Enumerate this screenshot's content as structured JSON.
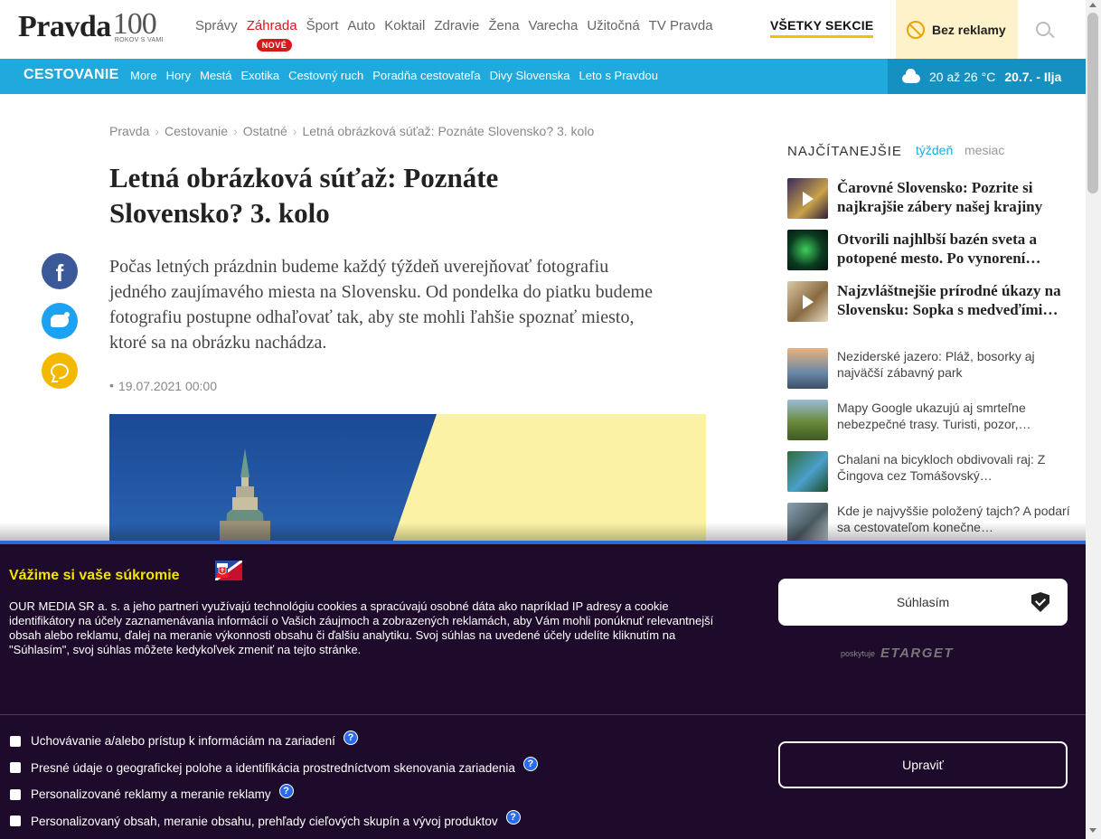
{
  "header": {
    "logo_word": "Pravda",
    "logo_number": "100",
    "logo_sub": "ROKOV S VAMI",
    "nav": [
      "Správy",
      "Záhrada",
      "Šport",
      "Auto",
      "Koktail",
      "Zdravie",
      "Žena",
      "Varecha",
      "Užitočná",
      "TV Pravda"
    ],
    "nav_active_index": 1,
    "new_badge": "NOVÉ",
    "all_sections": "VŠETKY SEKCIE",
    "no_ads": "Bez reklamy"
  },
  "section_bar": {
    "title": "CESTOVANIE",
    "links": [
      "More",
      "Hory",
      "Mestá",
      "Exotika",
      "Cestovný ruch",
      "Poradňa cestovateľa",
      "Divy Slovenska",
      "Leto s Pravdou"
    ],
    "weather_temp": "20 až 26 °C",
    "weather_date": "20.7. - Ilja"
  },
  "breadcrumb": [
    "Pravda",
    "Cestovanie",
    "Ostatné",
    "Letná obrázková súťaž: Poznáte Slovensko? 3. kolo"
  ],
  "article": {
    "title": "Letná obrázková súťaž: Poznáte Slovensko? 3. kolo",
    "perex": "Počas letných prázdnin budeme každý týždeň uverejňovať fotografiu jedného zaujímavého miesta na Slovensku. Od pondelka do piatku budeme fotografiu postupne odhaľovať tak, aby ste mohli ľahšie spoznať miesto, ktoré sa na obrázku nachádza.",
    "date": "19.07.2021 00:00"
  },
  "sidebar": {
    "heading": "NAJČÍTANEJŠIE",
    "tab_week": "týždeň",
    "tab_month": "mesiac",
    "items": [
      {
        "text": "Čarovné Slovensko: Pozrite si najkrajšie zábery našej krajiny",
        "bold": true,
        "video": true
      },
      {
        "text": "Otvorili najhlbší bazén sveta a potopené mesto. Po vynorení…",
        "bold": true,
        "video": false
      },
      {
        "text": "Najzvláštnejšie prírodné úkazy na Slovensku: Sopka s medveďími…",
        "bold": true,
        "video": true
      },
      {
        "text": "Neziderské jazero: Pláž, bosorky aj najväčší zábavný park",
        "bold": false,
        "video": false
      },
      {
        "text": "Mapy Google ukazujú aj smrteľne nebezpečné trasy. Turisti, pozor,…",
        "bold": false,
        "video": false
      },
      {
        "text": "Chalani na bicykloch obdivovali raj: Z Čingova cez Tomášovský…",
        "bold": false,
        "video": false
      },
      {
        "text": "Kde je najvyššie položený tajch? A podarí sa cestovateľom konečne…",
        "bold": false,
        "video": false
      }
    ]
  },
  "cookie_banner": {
    "title": "Vážime si vaše súkromie",
    "text": "OUR MEDIA SR a. s. a jeho partneri využívajú technológiu cookies a spracúvajú osobné dáta ako napríklad IP adresy a cookie identifikátory na účely zaznamenávania informácií o Vašich záujmoch a zobrazených reklamách, aby Vám mohli ponúknuť relevantnejší obsah alebo reklamu, ďalej na meranie výkonnosti obsahu či ďalšiu analytiku. Svoj súhlas na uvedené účely udelíte kliknutím na \"Súhlasím\", svoj súhlas môžete kedykoľvek zmeniť na tejto stránke.",
    "agree": "Súhlasím",
    "provided_by": "poskytuje",
    "provider": "ETARGET",
    "edit": "Upraviť",
    "options": [
      "Uchovávanie a/alebo prístup k informáciám na zariadení",
      "Presné údaje o geografickej polohe a identifikácia prostredníctvom skenovania zariadenia",
      "Personalizované reklamy a meranie reklamy",
      "Personalizovaný obsah, meranie obsahu, prehľady cieľových skupín a vývoj produktov"
    ]
  },
  "colors": {
    "accent_blue": "#1fa9dc",
    "active_red": "#d41a1a",
    "banner_bg": "#1e0a2a",
    "banner_title": "#f2e400"
  }
}
